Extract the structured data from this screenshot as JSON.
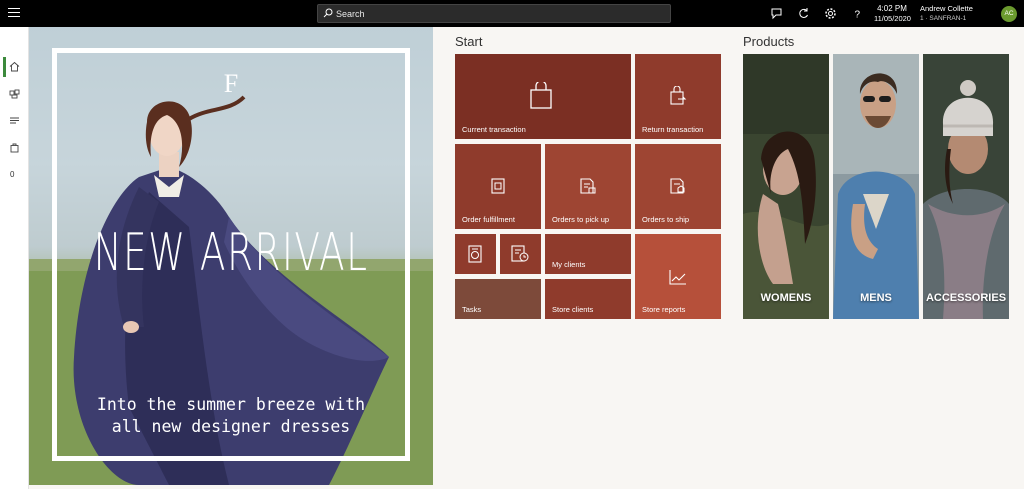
{
  "topbar": {
    "search_placeholder": "Search",
    "time": "4:02 PM",
    "date": "11/05/2020",
    "user_name": "Andrew Collette",
    "store": "1 · SANFRAN-1",
    "avatar_initials": "AC"
  },
  "sidebar": {
    "count": "0"
  },
  "hero": {
    "logo": "F",
    "title": "NEW ARRIVAL",
    "subtitle": "Into the summer breeze with all new designer dresses"
  },
  "start": {
    "title": "Start",
    "tiles": {
      "current_transaction": "Current transaction",
      "return_transaction": "Return transaction",
      "order_fulfillment": "Order fulfillment",
      "orders_to_pick_up": "Orders to pick up",
      "orders_to_ship": "Orders to ship",
      "my_clients": "My clients",
      "tasks": "Tasks",
      "store_clients": "Store clients",
      "store_reports": "Store reports"
    }
  },
  "products": {
    "title": "Products",
    "items": [
      "WOMENS",
      "MENS",
      "ACCESSORIES"
    ]
  },
  "colors": {
    "tile_dark": "#7b2f23",
    "tile_mid": "#8f3b2c",
    "tile_light": "#9e4533",
    "tile_report": "#b6503a",
    "tile_tasks": "#7d4a3a",
    "accent_green": "#3c8a3c"
  }
}
